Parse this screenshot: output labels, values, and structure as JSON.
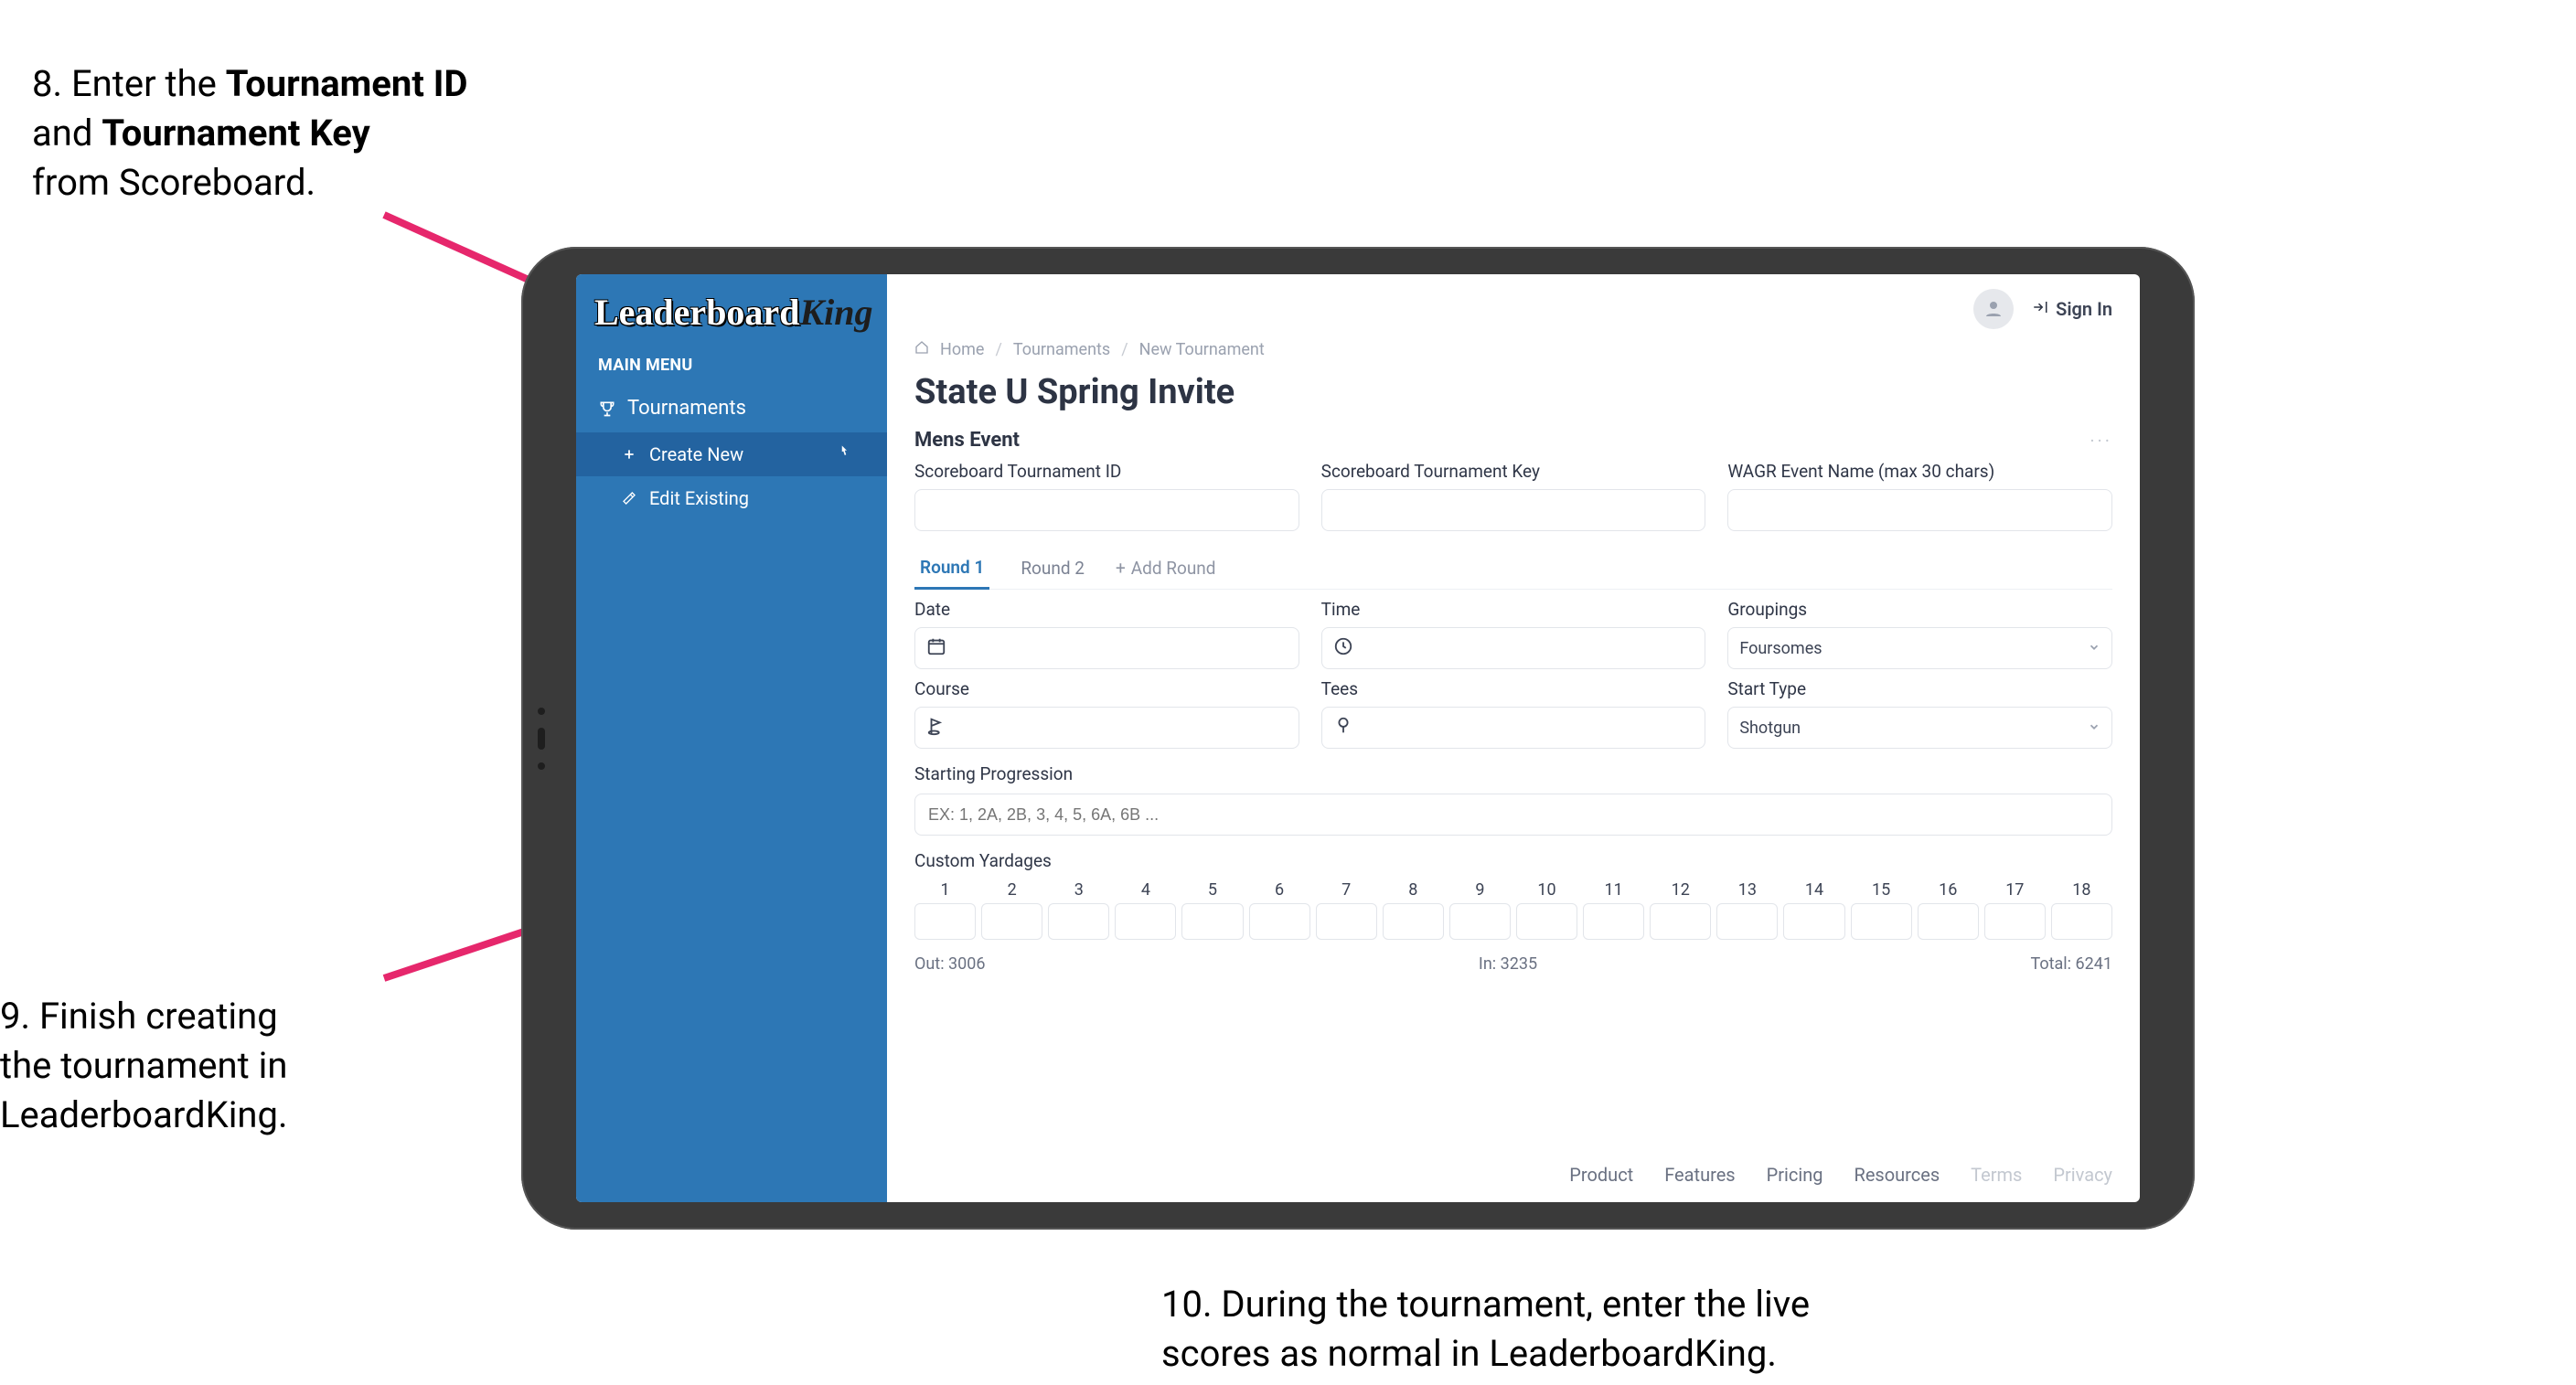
{
  "callouts": {
    "step8_line1_prefix": "8. Enter the ",
    "step8_bold1": "Tournament ID",
    "step8_line2_prefix": "and ",
    "step8_bold2": "Tournament Key",
    "step8_line3": "from Scoreboard.",
    "step9_line1": "9. Finish creating",
    "step9_line2": "the tournament in",
    "step9_line3": "LeaderboardKing.",
    "step10_line1": "10. During the tournament, enter the live",
    "step10_line2": "scores as normal in LeaderboardKing."
  },
  "logo": {
    "part1": "Leaderboard",
    "part2": "King"
  },
  "sidebar": {
    "menu_header": "MAIN MENU",
    "tournaments": "Tournaments",
    "create_new": "Create New",
    "edit_existing": "Edit Existing"
  },
  "header": {
    "sign_in": "Sign In"
  },
  "breadcrumb": {
    "home": "Home",
    "tournaments": "Tournaments",
    "new": "New Tournament"
  },
  "page": {
    "title": "State U Spring Invite",
    "section": "Mens Event"
  },
  "fields": {
    "scoreboard_id_label": "Scoreboard Tournament ID",
    "scoreboard_key_label": "Scoreboard Tournament Key",
    "wagr_label": "WAGR Event Name (max 30 chars)",
    "date_label": "Date",
    "time_label": "Time",
    "groupings_label": "Groupings",
    "groupings_value": "Foursomes",
    "course_label": "Course",
    "tees_label": "Tees",
    "start_type_label": "Start Type",
    "start_type_value": "Shotgun",
    "starting_progression_label": "Starting Progression",
    "starting_progression_placeholder": "EX: 1, 2A, 2B, 3, 4, 5, 6A, 6B ...",
    "custom_yardages_label": "Custom Yardages"
  },
  "tabs": {
    "round1": "Round 1",
    "round2": "Round 2",
    "add_round": "Add Round"
  },
  "yardage": {
    "holes": [
      "1",
      "2",
      "3",
      "4",
      "5",
      "6",
      "7",
      "8",
      "9",
      "10",
      "11",
      "12",
      "13",
      "14",
      "15",
      "16",
      "17",
      "18"
    ],
    "out_label": "Out:",
    "out_value": "3006",
    "in_label": "In:",
    "in_value": "3235",
    "total_label": "Total:",
    "total_value": "6241"
  },
  "footer": {
    "product": "Product",
    "features": "Features",
    "pricing": "Pricing",
    "resources": "Resources",
    "terms": "Terms",
    "privacy": "Privacy"
  }
}
